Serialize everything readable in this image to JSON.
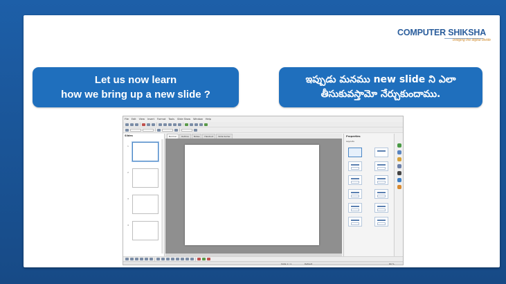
{
  "logo": {
    "brand": "COMPUTER SHIKSHA",
    "tagline": "bridging the digital divide"
  },
  "callouts": {
    "english_line1": "Let us now learn",
    "english_line2": "how we bring up a new slide ?",
    "telugu_line1": "ఇప్పుడు మనము new slide ని ఎలా",
    "telugu_line2": "తీసుకువస్తామో నేర్చుకుందాము."
  },
  "screenshot": {
    "menu": [
      "File",
      "Edit",
      "View",
      "Insert",
      "Format",
      "Tools",
      "Slide Show",
      "Window",
      "Help"
    ],
    "slides_pane_title": "Slides",
    "slide_numbers": [
      "1",
      "2",
      "3",
      "4"
    ],
    "view_tabs": [
      "Normal",
      "Outline",
      "Notes",
      "Handout",
      "Slide Sorter"
    ],
    "properties_title": "Properties",
    "layouts_label": "Layouts",
    "status_left": "Slide 1 / 1",
    "status_theme": "Default",
    "status_zoom": "60 %"
  },
  "colors": {
    "background": "#1f4f8f",
    "callout": "#1f6fbd",
    "brand": "#2a5d9c"
  }
}
